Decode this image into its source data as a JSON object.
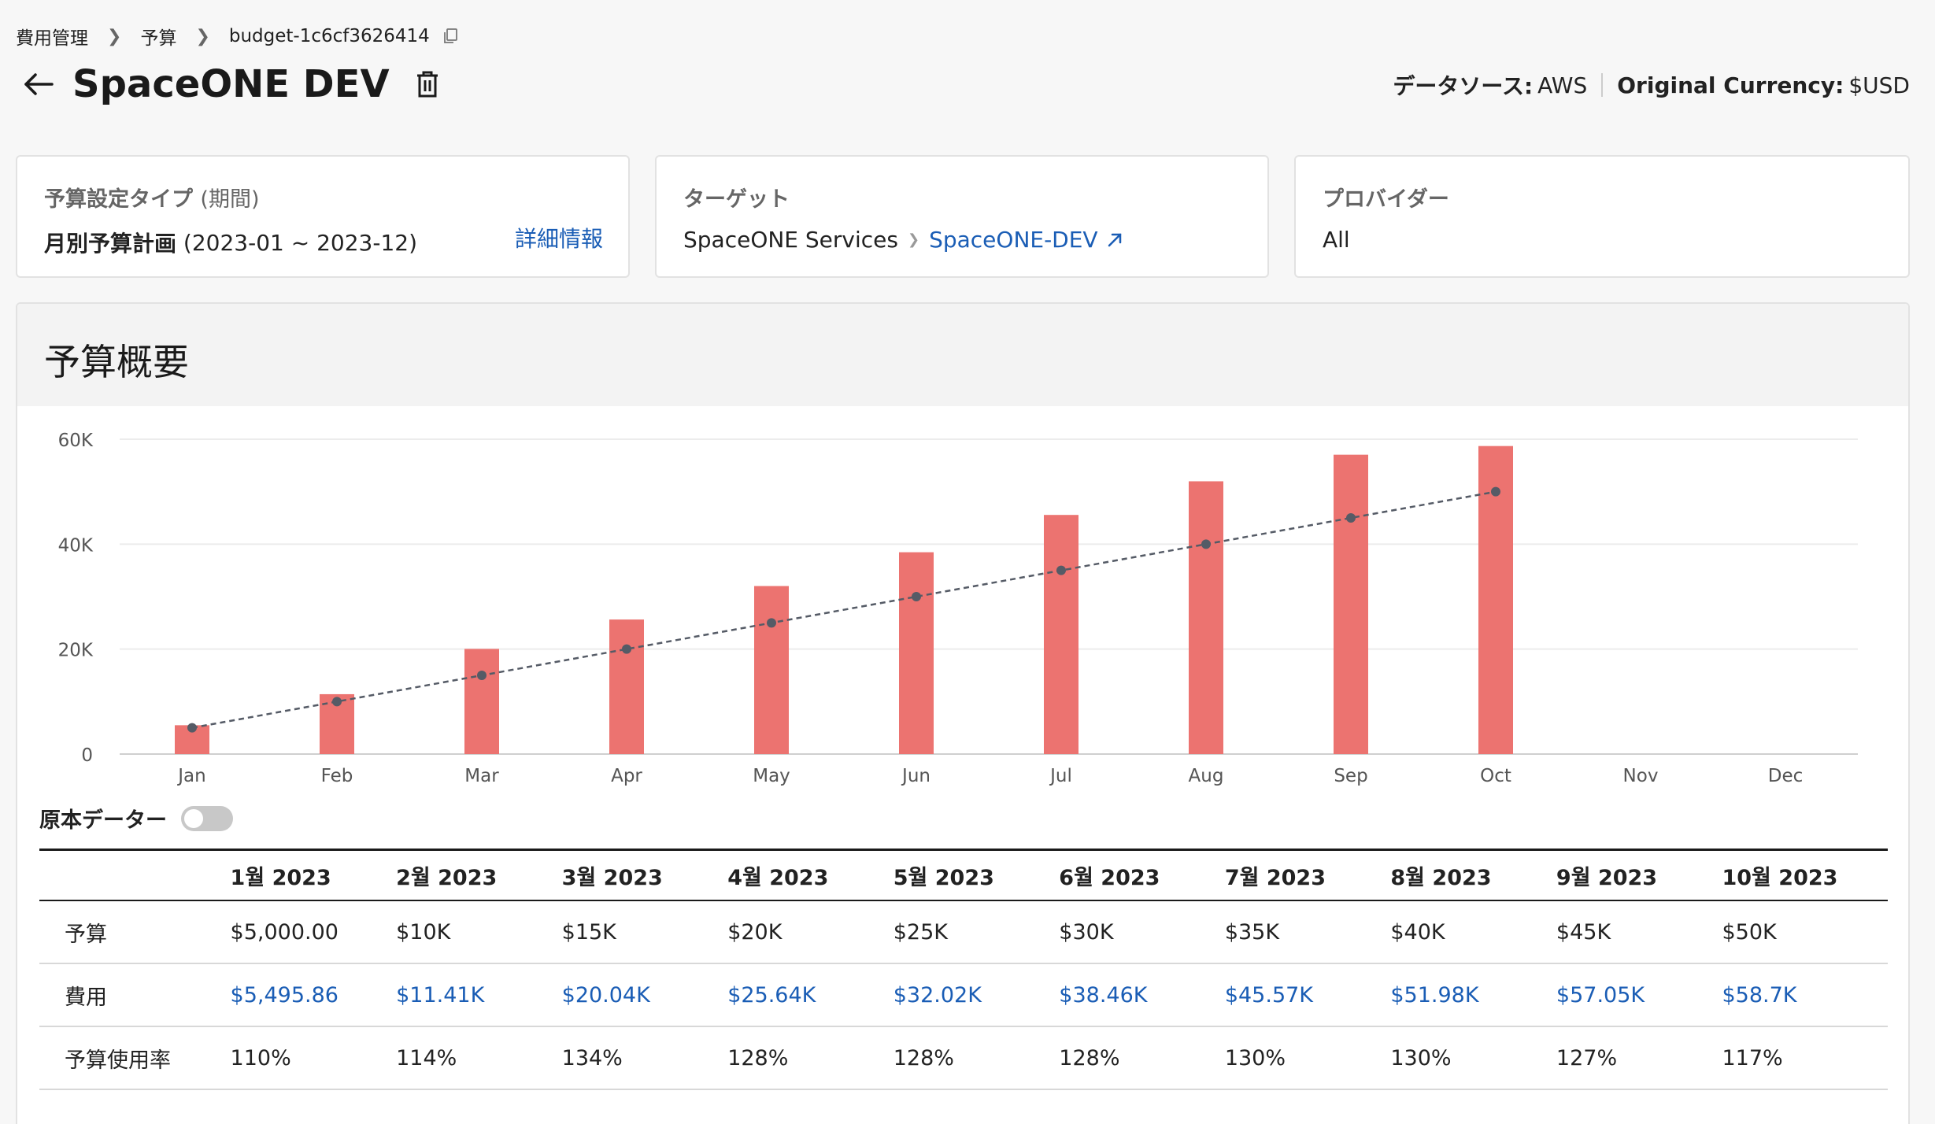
{
  "breadcrumb": {
    "items": [
      "費用管理",
      "予算",
      "budget-1c6cf3626414"
    ]
  },
  "title": "SpaceONE DEV",
  "meta": {
    "datasource_label": "データソース:",
    "datasource_value": "AWS",
    "currency_label": "Original Currency:",
    "currency_value": "$USD"
  },
  "cards": {
    "budget_type": {
      "label": "予算設定タイプ",
      "label_paren": "(期間)",
      "value_bold": "月別予算計画",
      "value_range": "(2023-01 ~ 2023-12)",
      "detail_link": "詳細情報"
    },
    "target": {
      "label": "ターゲット",
      "parent": "SpaceONE Services",
      "child": "SpaceONE-DEV"
    },
    "provider": {
      "label": "プロバイダー",
      "value": "All"
    }
  },
  "overview": {
    "title": "予算概要",
    "original_data_label": "原本データー",
    "original_data_enabled": false
  },
  "colors": {
    "bar": "#ec7370",
    "line": "#555b66",
    "link": "#1a5db5"
  },
  "chart_data": {
    "type": "bar",
    "categories": [
      "Jan",
      "Feb",
      "Mar",
      "Apr",
      "May",
      "Jun",
      "Jul",
      "Aug",
      "Sep",
      "Oct",
      "Nov",
      "Dec"
    ],
    "series": [
      {
        "values": [
          5495.86,
          11410,
          20040,
          25640,
          32020,
          38460,
          45570,
          51980,
          57050,
          58700,
          null,
          null
        ],
        "type": "bar"
      },
      {
        "values": [
          5000,
          10000,
          15000,
          20000,
          25000,
          30000,
          35000,
          40000,
          45000,
          50000,
          null,
          null
        ],
        "type": "line-dashed"
      }
    ],
    "y_ticks": [
      "0",
      "20K",
      "40K",
      "60K"
    ],
    "ylim": [
      0,
      60000
    ],
    "grid": true
  },
  "table": {
    "headers": [
      "1월 2023",
      "2월 2023",
      "3월 2023",
      "4월 2023",
      "5월 2023",
      "6월 2023",
      "7월 2023",
      "8월 2023",
      "9월 2023",
      "10월 2023"
    ],
    "rows": [
      {
        "label": "予算",
        "values": [
          "$5,000.00",
          "$10K",
          "$15K",
          "$20K",
          "$25K",
          "$30K",
          "$35K",
          "$40K",
          "$45K",
          "$50K"
        ]
      },
      {
        "label": "費用",
        "values": [
          "$5,495.86",
          "$11.41K",
          "$20.04K",
          "$25.64K",
          "$32.02K",
          "$38.46K",
          "$45.57K",
          "$51.98K",
          "$57.05K",
          "$58.7K"
        ]
      },
      {
        "label": "予算使用率",
        "values": [
          "110%",
          "114%",
          "134%",
          "128%",
          "128%",
          "128%",
          "130%",
          "130%",
          "127%",
          "117%"
        ]
      }
    ]
  }
}
